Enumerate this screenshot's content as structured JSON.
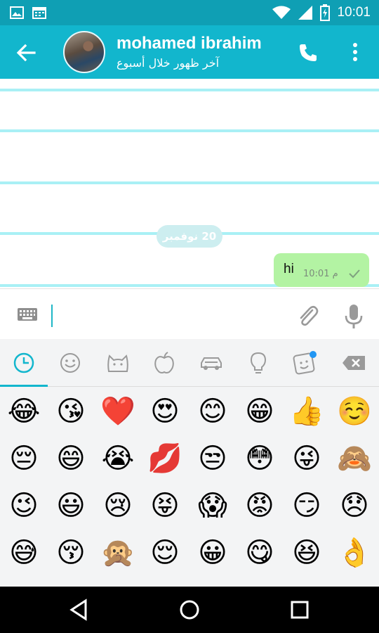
{
  "status_bar": {
    "time": "10:01"
  },
  "app_bar": {
    "contact_name": "mohamed ibrahim",
    "last_seen": "آخر ظهور خلال أسبوع"
  },
  "chat": {
    "date_separator": "20 نوفمبر",
    "messages": [
      {
        "text": "hi",
        "time": "10:01 م",
        "status": "sent",
        "direction": "outgoing"
      }
    ]
  },
  "emoji_tabs": [
    {
      "icon": "clock-icon",
      "selected": true
    },
    {
      "icon": "smiley-icon",
      "selected": false
    },
    {
      "icon": "cat-icon",
      "selected": false
    },
    {
      "icon": "apple-icon",
      "selected": false
    },
    {
      "icon": "car-icon",
      "selected": false
    },
    {
      "icon": "lightbulb-icon",
      "selected": false
    },
    {
      "icon": "sticker-icon",
      "selected": false
    },
    {
      "icon": "backspace-icon",
      "selected": false
    }
  ],
  "emojis": [
    [
      "😂",
      "😘",
      "❤️",
      "😍",
      "😊",
      "😁",
      "👍",
      "☺️"
    ],
    [
      "😔",
      "😄",
      "😭",
      "💋",
      "😒",
      "😳",
      "😜",
      "🙈"
    ],
    [
      "😉",
      "😃",
      "😢",
      "😝",
      "😱",
      "😡",
      "😏",
      "😞"
    ],
    [
      "😅",
      "😚",
      "🙊",
      "😌",
      "😀",
      "😋",
      "😆",
      "👌"
    ]
  ],
  "colors": {
    "status_bar": "#0f9fb4",
    "app_bar": "#12b6cd",
    "bubble_outgoing": "#b3f3a3",
    "accent": "#12b6cd"
  }
}
